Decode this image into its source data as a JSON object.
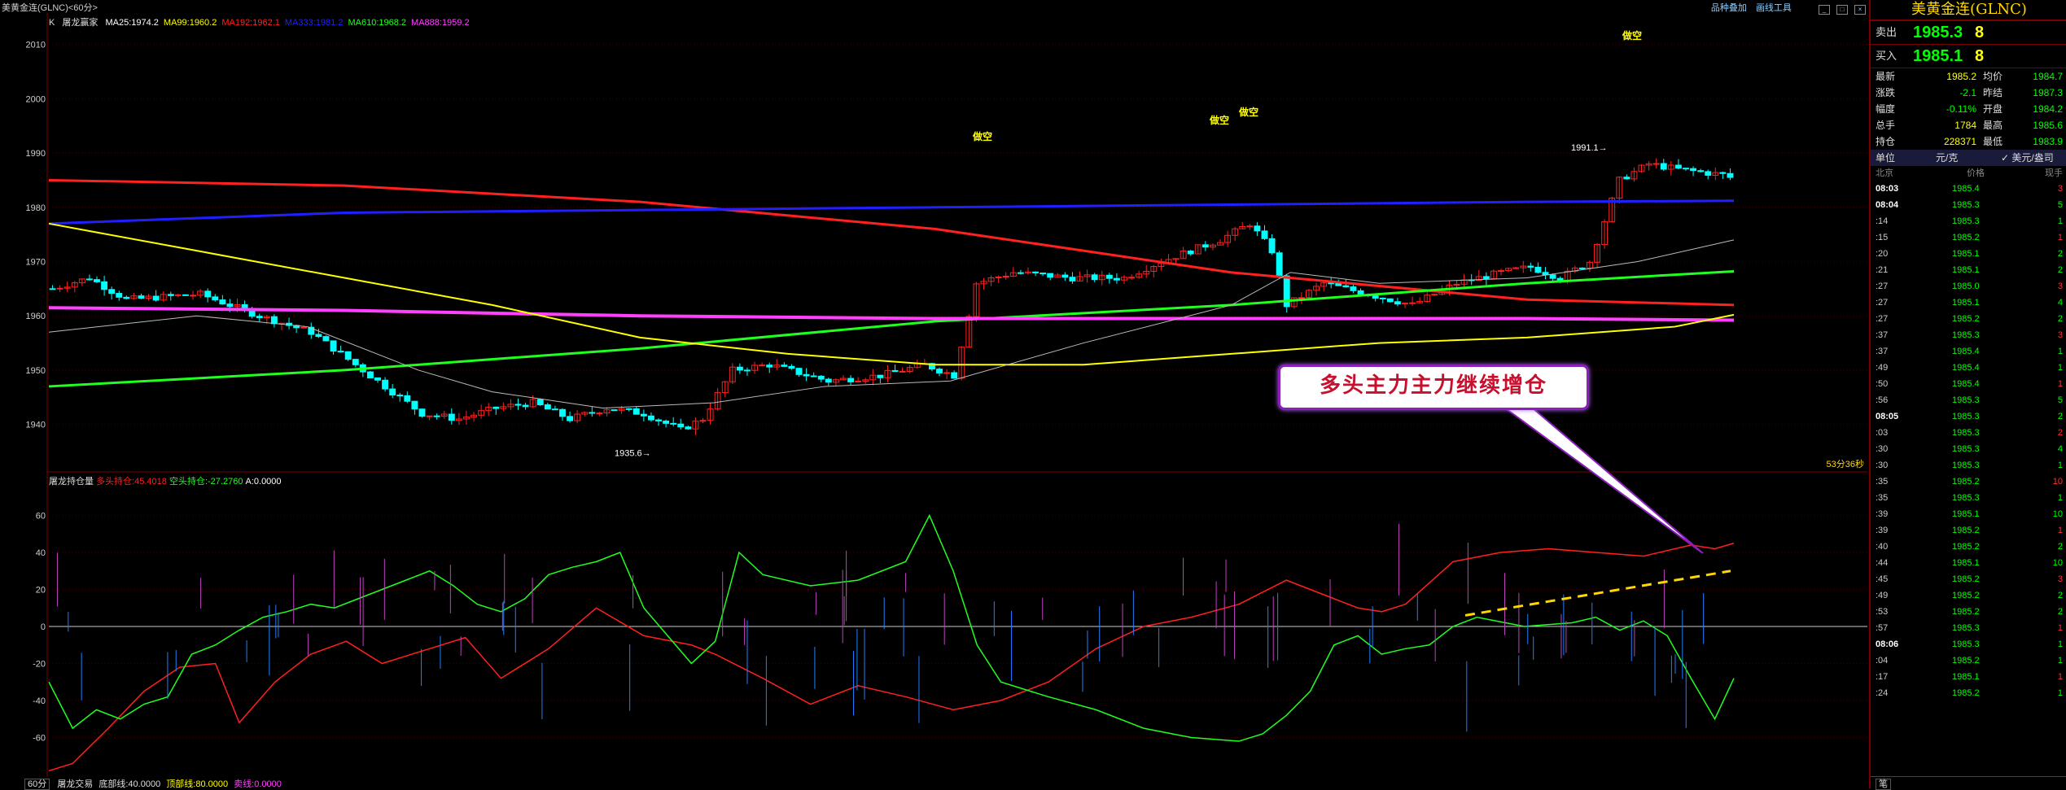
{
  "window": {
    "title": "美黄金连(GLNC)<60分>",
    "links": [
      "品种叠加",
      "画线工具"
    ]
  },
  "ma_bar": {
    "k_label": "K",
    "indicator": "屠龙赢家",
    "items": [
      {
        "text": "MA25:1974.2",
        "color": "#ffffff"
      },
      {
        "text": "MA99:1960.2",
        "color": "#ffff00"
      },
      {
        "text": "MA192:1962.1",
        "color": "#ff2020"
      },
      {
        "text": "MA333:1981.2",
        "color": "#2020ff"
      },
      {
        "text": "MA610:1968.2",
        "color": "#20ff20"
      },
      {
        "text": "MA888:1959.2",
        "color": "#ff40ff"
      }
    ]
  },
  "price_axis": [
    "2010",
    "2000",
    "1990",
    "1980",
    "1970",
    "1960",
    "1950",
    "1940"
  ],
  "price_chart": {
    "high_label": "1991.1→",
    "low_label": "1935.6→",
    "signal_labels": [
      "做空",
      "做空",
      "做空",
      "做空"
    ],
    "countdown": "53分36秒"
  },
  "sub_chart": {
    "title": "屠龙持仓量",
    "long_label": "多头持仓:45.4018",
    "short_label": "空头持仓:-27.2760",
    "a_label": "A:0.0000",
    "axis": [
      "60",
      "40",
      "20",
      "0",
      "-20",
      "-40",
      "-60"
    ]
  },
  "callout": "多头主力主力继续增仓",
  "bottom": {
    "period": "60分",
    "indicator": "屠龙交易",
    "bottom_line": "底部线:40.0000",
    "top_line": "顶部线:80.0000",
    "sell_line": "卖线:0.0000"
  },
  "panel": {
    "title": "美黄金连(GLNC)",
    "sell_label": "卖出",
    "sell_price": "1985.3",
    "sell_qty": "8",
    "buy_label": "买入",
    "buy_price": "1985.1",
    "buy_qty": "8",
    "stats": [
      {
        "l1": "最新",
        "v1": "1985.2",
        "l2": "均价",
        "v2": "1984.7"
      },
      {
        "l1": "涨跌",
        "v1": "-2.1",
        "l2": "昨结",
        "v2": "1987.3"
      },
      {
        "l1": "幅度",
        "v1": "-0.11%",
        "l2": "开盘",
        "v2": "1984.2"
      },
      {
        "l1": "总手",
        "v1": "1784",
        "l2": "最高",
        "v2": "1985.6"
      },
      {
        "l1": "持仓",
        "v1": "228371",
        "l2": "最低",
        "v2": "1983.9"
      }
    ],
    "unit_label": "单位",
    "unit_value": "元/克",
    "unit_check": "✓ 美元/盎司",
    "tick_head": {
      "time": "北京",
      "price": "价格",
      "vol": "现手"
    },
    "ticks": [
      {
        "t": "08:03",
        "p": "1985.4",
        "v": "3",
        "bold": true
      },
      {
        "t": "08:04",
        "p": "1985.3",
        "v": "5",
        "bold": true
      },
      {
        "t": ":14",
        "p": "1985.3",
        "v": "1"
      },
      {
        "t": ":15",
        "p": "1985.2",
        "v": "1"
      },
      {
        "t": ":20",
        "p": "1985.1",
        "v": "2"
      },
      {
        "t": ":21",
        "p": "1985.1",
        "v": "2"
      },
      {
        "t": ":27",
        "p": "1985.0",
        "v": "3"
      },
      {
        "t": ":27",
        "p": "1985.1",
        "v": "4"
      },
      {
        "t": ":27",
        "p": "1985.2",
        "v": "2"
      },
      {
        "t": ":37",
        "p": "1985.3",
        "v": "3"
      },
      {
        "t": ":37",
        "p": "1985.4",
        "v": "1"
      },
      {
        "t": ":49",
        "p": "1985.4",
        "v": "1"
      },
      {
        "t": ":50",
        "p": "1985.4",
        "v": "1"
      },
      {
        "t": ":56",
        "p": "1985.3",
        "v": "5"
      },
      {
        "t": "08:05",
        "p": "1985.3",
        "v": "2",
        "bold": true
      },
      {
        "t": ":03",
        "p": "1985.3",
        "v": "2"
      },
      {
        "t": ":30",
        "p": "1985.3",
        "v": "4"
      },
      {
        "t": ":30",
        "p": "1985.3",
        "v": "1"
      },
      {
        "t": ":35",
        "p": "1985.2",
        "v": "10"
      },
      {
        "t": ":35",
        "p": "1985.3",
        "v": "1"
      },
      {
        "t": ":39",
        "p": "1985.1",
        "v": "10"
      },
      {
        "t": ":39",
        "p": "1985.2",
        "v": "1"
      },
      {
        "t": ":40",
        "p": "1985.2",
        "v": "2"
      },
      {
        "t": ":44",
        "p": "1985.1",
        "v": "10"
      },
      {
        "t": ":45",
        "p": "1985.2",
        "v": "3"
      },
      {
        "t": ":49",
        "p": "1985.2",
        "v": "2"
      },
      {
        "t": ":53",
        "p": "1985.2",
        "v": "2"
      },
      {
        "t": ":57",
        "p": "1985.3",
        "v": "1"
      },
      {
        "t": "08:06",
        "p": "1985.3",
        "v": "1",
        "bold": true
      },
      {
        "t": ":04",
        "p": "1985.2",
        "v": "1"
      },
      {
        "t": ":17",
        "p": "1985.1",
        "v": "1"
      },
      {
        "t": ":24",
        "p": "1985.2",
        "v": "1"
      }
    ],
    "footer_tab": "笔"
  },
  "colors": {
    "up": "#ff2020",
    "down": "#00ffff",
    "bg": "#000000",
    "grid": "#550000",
    "accent": "#8b1fb8"
  }
}
